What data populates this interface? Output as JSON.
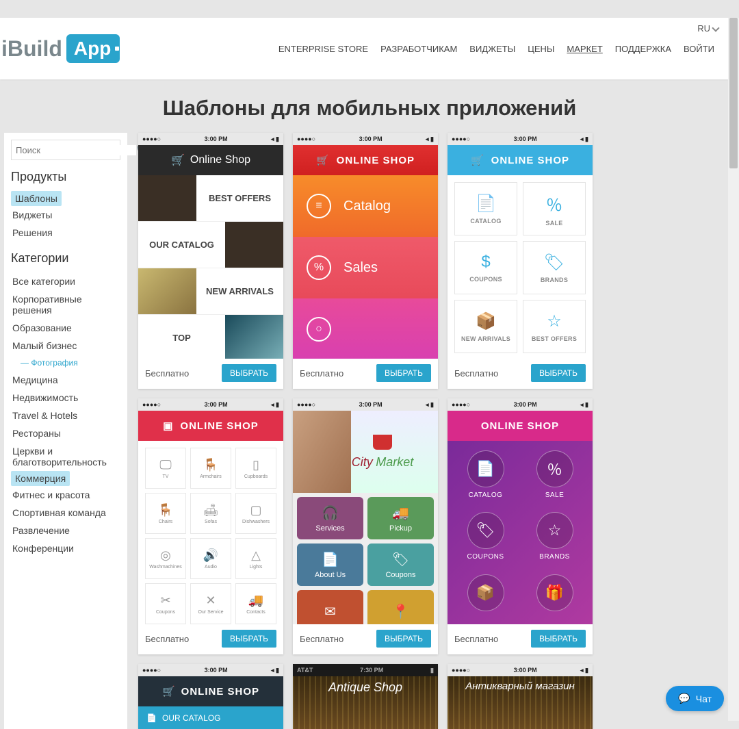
{
  "lang_selector": "RU",
  "logo": {
    "part1": "iBuild",
    "part2": "App"
  },
  "nav": [
    {
      "label": "ENTERPRISE STORE",
      "active": false
    },
    {
      "label": "РАЗРАБОТЧИКАМ",
      "active": false
    },
    {
      "label": "ВИДЖЕТЫ",
      "active": false
    },
    {
      "label": "ЦЕНЫ",
      "active": false
    },
    {
      "label": "МАРКЕТ",
      "active": true
    },
    {
      "label": "ПОДДЕРЖКА",
      "active": false
    },
    {
      "label": "ВОЙТИ",
      "active": false
    }
  ],
  "page_title": "Шаблоны для мобильных приложений",
  "search_placeholder": "Поиск",
  "sidebar": {
    "products_head": "Продукты",
    "products": [
      {
        "label": "Шаблоны",
        "selected": true
      },
      {
        "label": "Виджеты",
        "selected": false
      },
      {
        "label": "Решения",
        "selected": false
      }
    ],
    "categories_head": "Категории",
    "categories": [
      {
        "label": "Все категории"
      },
      {
        "label": "Корпоративные решения"
      },
      {
        "label": "Образование"
      },
      {
        "label": "Малый бизнес",
        "sub": "Фотография"
      },
      {
        "label": "Медицина"
      },
      {
        "label": "Недвижимость"
      },
      {
        "label": "Travel & Hotels"
      },
      {
        "label": "Рестораны"
      },
      {
        "label": "Церкви и благотворительность"
      },
      {
        "label": "Коммерция",
        "selected": true
      },
      {
        "label": "Фитнес и красота"
      },
      {
        "label": "Спортивная команда"
      },
      {
        "label": "Развлечение"
      },
      {
        "label": "Конференции"
      }
    ]
  },
  "status": {
    "time": "3:00 PM",
    "time_alt": "7:30 PM",
    "carrier": "AT&T",
    "dots": "●●●●○"
  },
  "templates": [
    {
      "header": "Online Shop",
      "rows": [
        "BEST OFFERS",
        "OUR CATALOG",
        "NEW ARRIVALS",
        "TOP"
      ],
      "price": "Бесплатно",
      "btn": "ВЫБРАТЬ"
    },
    {
      "header": "ONLINE SHOP",
      "rows": [
        "Catalog",
        "Sales",
        ""
      ],
      "price": "Бесплатно",
      "btn": "ВЫБРАТЬ"
    },
    {
      "header": "ONLINE SHOP",
      "cells": [
        "CATALOG",
        "SALE",
        "COUPONS",
        "BRANDS",
        "NEW ARRIVALS",
        "BEST OFFERS"
      ],
      "price": "Бесплатно",
      "btn": "ВЫБРАТЬ"
    },
    {
      "header": "ONLINE SHOP",
      "cells": [
        "TV",
        "Armchairs",
        "Cupboards",
        "Chairs",
        "Sofas",
        "Dishwashers",
        "Washmachines",
        "Audio",
        "Lights",
        "Coupons",
        "Our Service",
        "Contacts"
      ],
      "price": "Бесплатно",
      "btn": "ВЫБРАТЬ"
    },
    {
      "logo1": "City",
      "logo2": "Market",
      "cells": [
        "Services",
        "Pickup",
        "About Us",
        "Coupons"
      ],
      "price": "Бесплатно",
      "btn": "ВЫБРАТЬ"
    },
    {
      "header": "ONLINE SHOP",
      "cells": [
        "CATALOG",
        "SALE",
        "COUPONS",
        "BRANDS"
      ],
      "price": "Бесплатно",
      "btn": "ВЫБРАТЬ"
    },
    {
      "header": "ONLINE SHOP",
      "sub": "OUR CATALOG"
    },
    {
      "header": "Antique Shop"
    },
    {
      "header": "Антикварный магазин"
    }
  ],
  "chat": "Чат"
}
